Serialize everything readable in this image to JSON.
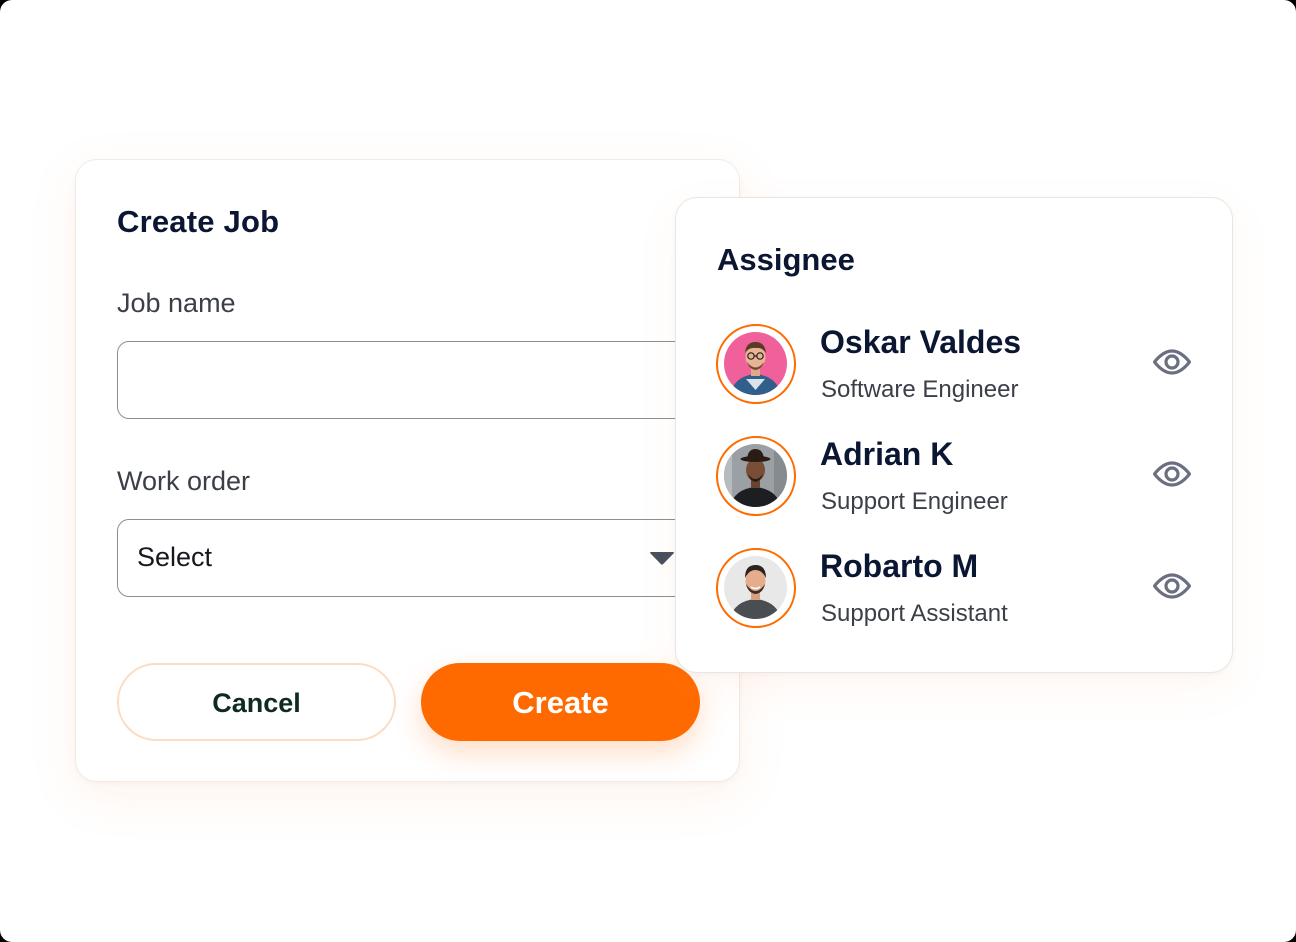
{
  "create_job": {
    "title": "Create Job",
    "job_name_label": "Job name",
    "job_name_value": "",
    "work_order_label": "Work order",
    "work_order_selected": "Select",
    "cancel_label": "Cancel",
    "create_label": "Create"
  },
  "assignee": {
    "title": "Assignee",
    "people": [
      {
        "name": "Oskar Valdes",
        "role": "Software Engineer",
        "avatar_bg": "#f0609a",
        "action_icon": "eye-icon"
      },
      {
        "name": "Adrian K",
        "role": "Support Engineer",
        "avatar_bg": "#9aa0a3",
        "action_icon": "eye-icon"
      },
      {
        "name": "Robarto M",
        "role": "Support Assistant",
        "avatar_bg": "#e8e8e8",
        "action_icon": "eye-icon"
      }
    ]
  },
  "colors": {
    "accent": "#ff6a00",
    "heading": "#0b1633",
    "body_text": "#3b3f48",
    "icon": "#6b7080"
  }
}
